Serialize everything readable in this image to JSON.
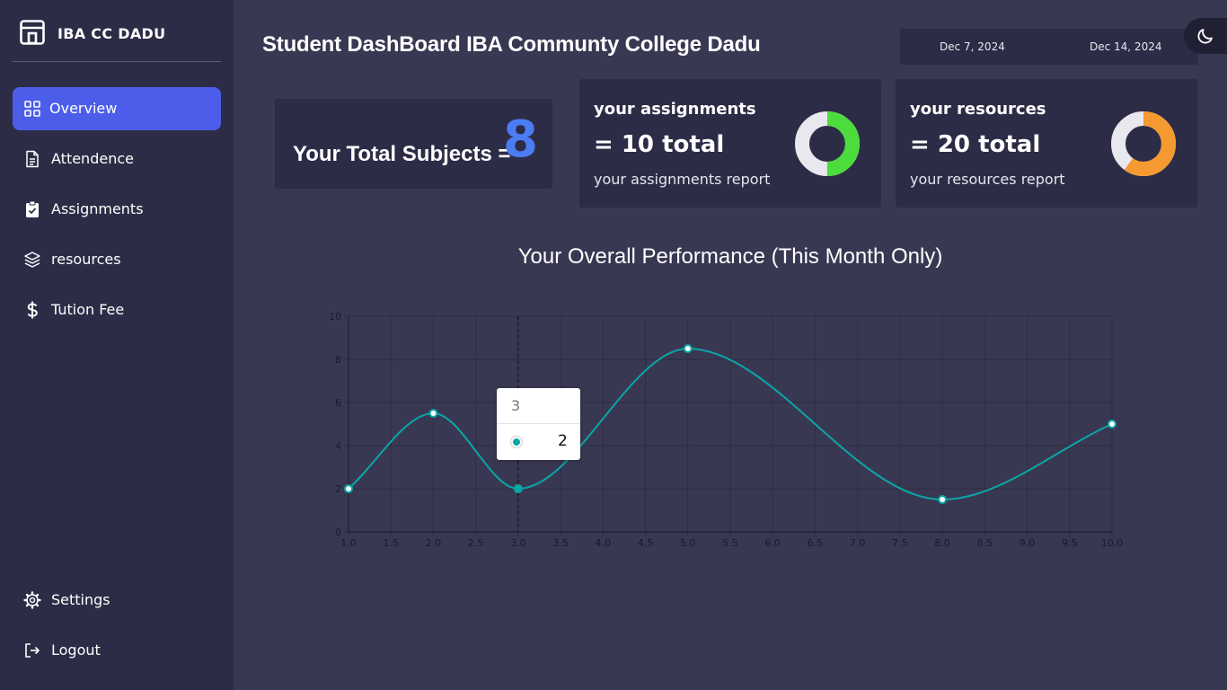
{
  "sidebar": {
    "brand": "IBA CC DADU",
    "items": [
      {
        "label": "Overview",
        "icon": "grid-icon"
      },
      {
        "label": "Attendence",
        "icon": "document-icon"
      },
      {
        "label": "Assignments",
        "icon": "clipboard-check-icon"
      },
      {
        "label": "resources",
        "icon": "layers-icon"
      },
      {
        "label": "Tution Fee",
        "icon": "dollar-icon"
      }
    ],
    "bottom": [
      {
        "label": "Settings",
        "icon": "gear-icon"
      },
      {
        "label": "Logout",
        "icon": "logout-icon"
      }
    ]
  },
  "header": {
    "title": "Student DashBoard IBA Communty College Dadu",
    "date_from": "Dec 7, 2024",
    "date_to": "Dec 14, 2024",
    "theme_icon": "moon-icon"
  },
  "cards": {
    "subjects": {
      "label": "Your Total Subjects =",
      "value": "8"
    },
    "assignments": {
      "title": "your assignments",
      "total": "= 10 total",
      "report": "your assignments report",
      "donut_fraction": 0.5,
      "donut_color": "#4cdd3c"
    },
    "resources": {
      "title": "your resources",
      "total": "= 20 total",
      "report": "your resources report",
      "donut_fraction": 0.6,
      "donut_color": "#f59a30"
    }
  },
  "colors": {
    "accent": "#4c5ee9",
    "subjects_number": "#4b7cf3",
    "line": "#0aa6a6",
    "donut_track": "#e8e8ee"
  },
  "chart_title": "Your Overall Performance (This Month Only)",
  "chart_data": {
    "type": "line",
    "x": [
      1,
      2,
      3,
      5,
      8,
      10
    ],
    "series": [
      {
        "values": [
          2,
          5.5,
          2,
          8.5,
          1.5,
          5
        ]
      }
    ],
    "xlim": [
      1,
      10
    ],
    "ylim": [
      0,
      10
    ],
    "xticks": [
      "1.0",
      "1.5",
      "2.0",
      "2.5",
      "3.0",
      "3.5",
      "4.0",
      "4.5",
      "5.0",
      "5.5",
      "6.0",
      "6.5",
      "7.0",
      "7.5",
      "8.0",
      "8.5",
      "9.0",
      "9.5",
      "10.0"
    ],
    "yticks": [
      "0",
      "2",
      "4",
      "6",
      "8",
      "10"
    ],
    "grid": true,
    "highlighted_x": 3
  },
  "tooltip": {
    "x": "3",
    "value": "2"
  }
}
